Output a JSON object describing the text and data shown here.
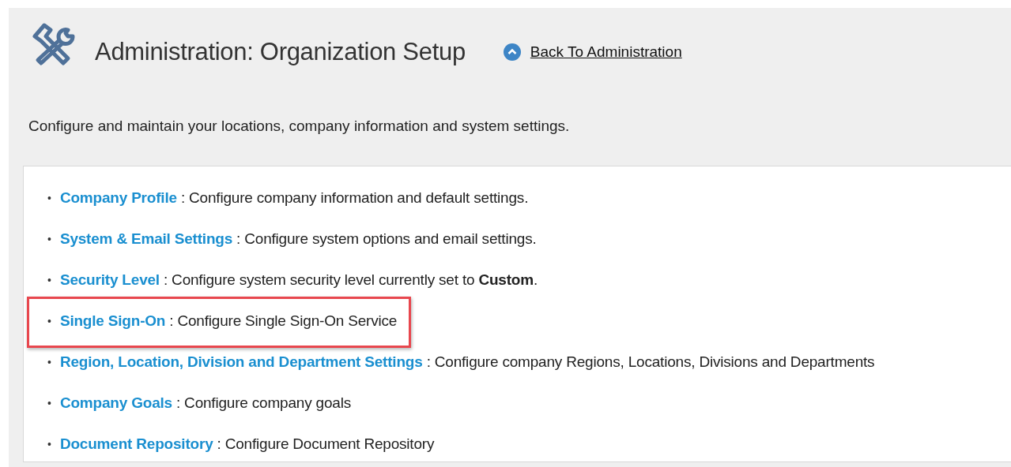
{
  "header": {
    "title": "Administration: Organization Setup",
    "back_link": "Back To Administration"
  },
  "intro": "Configure and maintain your locations, company information and system settings.",
  "items": [
    {
      "bullet": "•",
      "link": "Company Profile",
      "description": ": Configure company information and default settings.",
      "highlighted": false
    },
    {
      "bullet": "•",
      "link": "System & Email Settings",
      "description": ": Configure system options and email settings.",
      "highlighted": false
    },
    {
      "bullet": "•",
      "link": "Security Level",
      "description": ": Configure system security level currently set to **Custom**.",
      "highlighted": false
    },
    {
      "bullet": "•",
      "link": "Single Sign-On",
      "description": ": Configure Single Sign-On Service",
      "highlighted": true
    },
    {
      "bullet": "•",
      "link": "Region, Location, Division and Department Settings",
      "description": ": Configure company Regions, Locations, Divisions and Departments",
      "highlighted": false
    },
    {
      "bullet": "•",
      "link": "Company Goals",
      "description": ": Configure company goals",
      "highlighted": false
    },
    {
      "bullet": "•",
      "link": "Document Repository",
      "description": ": Configure Document Repository",
      "highlighted": false
    }
  ]
}
